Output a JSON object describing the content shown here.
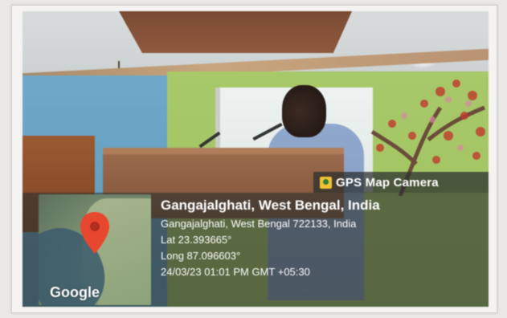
{
  "overlay": {
    "app_name": "GPS Map Camera",
    "app_icon": "map-camera-icon",
    "location_title": "Gangajalghati, West Bengal, India",
    "address": "Gangajalghati, West Bengal 722133, India",
    "latitude": "Lat 23.393665°",
    "longitude": "Long 87.096603°",
    "datetime": "24/03/23 01:01 PM GMT +05:30",
    "map_label": "Google",
    "pin_icon": "map-pin-icon"
  },
  "colors": {
    "pin": "#e8472f",
    "overlay_bg": "#2d302e",
    "text": "#ffffff"
  }
}
